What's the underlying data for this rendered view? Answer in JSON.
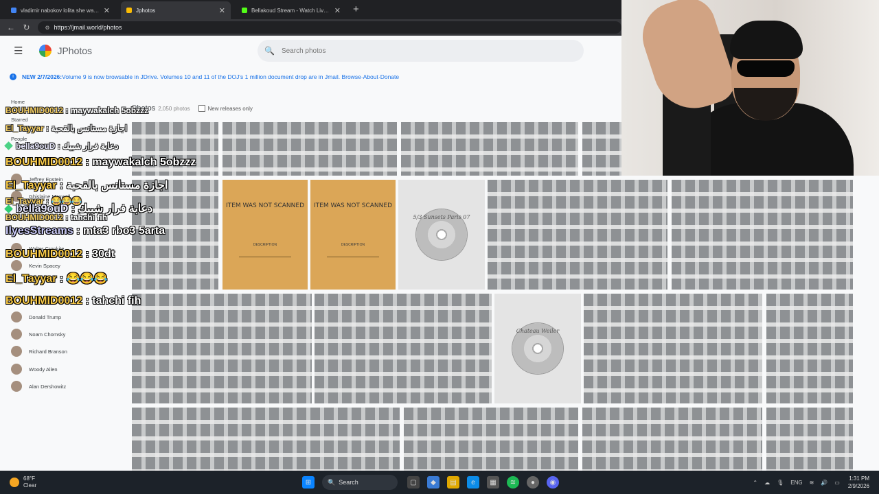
{
  "browser": {
    "tabs": [
      {
        "title": "vladimir nabokov lolita she was lo",
        "favicon_color": "#4285f4",
        "active": false
      },
      {
        "title": "Jphotos",
        "favicon_color": "#fbbc04",
        "active": true
      },
      {
        "title": "Bellakoud Stream - Watch Live on",
        "favicon_color": "#53fc18",
        "active": false
      }
    ],
    "new_tab_label": "+",
    "url": "https://jmail.world/photos"
  },
  "app": {
    "brand": "JPhotos",
    "search_placeholder": "Search photos",
    "notice": {
      "lead": "NEW 2/7/2026:",
      "text": " Volume 9 is now browsable in JDrive. Volumes 10 and 11 of the DOJ's 1 million document drop are in Jmail.",
      "links": [
        "Browse",
        "About",
        "Donate"
      ],
      "separator": " · "
    },
    "sidebar": {
      "home": "Home",
      "starred": "Starred",
      "people_heading": "People",
      "people": [
        "Jeffrey Epstein",
        "Ghislaine Maxwell",
        "Walter Cronkite",
        "Kevin Spacey",
        "Donald Trump",
        "Noam Chomsky",
        "Richard Branson",
        "Woody Allen",
        "Alan Dershowitz"
      ]
    },
    "toolbar": {
      "title": "Photos",
      "count": "2,050 photos",
      "new_releases": "New releases only"
    },
    "placeholders": {
      "not_scanned": "ITEM WAS NOT SCANNED",
      "description": "DESCRIPTION"
    },
    "cd_labels": [
      "5/3 Sunsets Paris 07",
      "Chateau Weiler"
    ]
  },
  "chat": [
    {
      "user": "BOUHMID0012",
      "msg": "maywakalch 5obzzz",
      "size": "sm",
      "color": "g"
    },
    {
      "user": "El_Tayyar",
      "msg": "اجازة مستانس بالقحبة",
      "size": "sm",
      "color": "g"
    },
    {
      "user": "bella9ouD",
      "msg": "دعابة فرار شبيك",
      "size": "sm",
      "color": "w",
      "badge": true
    },
    {
      "user": "BOUHMID0012",
      "msg": "maywakalch 5obzzz",
      "size": "lg",
      "color": "g"
    },
    {
      "user": "El_Tayyar",
      "msg": "اجازة مستانس بالقحبة",
      "size": "lg",
      "color": "g"
    },
    {
      "user": "El_Tayyar",
      "msg": "😂😂😂",
      "size": "sm",
      "color": "g"
    },
    {
      "user": "bella9ouD",
      "msg": "دعابة فرار شبيك",
      "size": "lg",
      "color": "w",
      "badge": true
    },
    {
      "user": "BOUHMID0012",
      "msg": "tahchi fih",
      "size": "sm",
      "color": "g"
    },
    {
      "user": "IlyesStreams",
      "msg": "mta3 rbo3 5arta",
      "size": "lg",
      "color": "p"
    },
    {
      "user": "BOUHMID0012",
      "msg": "30dt",
      "size": "lg",
      "color": "g"
    },
    {
      "user": "El_Tayyar",
      "msg": "😂😂😂",
      "size": "lg",
      "color": "g"
    },
    {
      "user": "BOUHMID0012",
      "msg": "tahchi fih",
      "size": "lg",
      "color": "g"
    }
  ],
  "taskbar": {
    "temperature": "68°F",
    "condition": "Clear",
    "search": "Search",
    "lang": "ENG",
    "time": "1:31 PM",
    "date": "2/9/2026"
  }
}
